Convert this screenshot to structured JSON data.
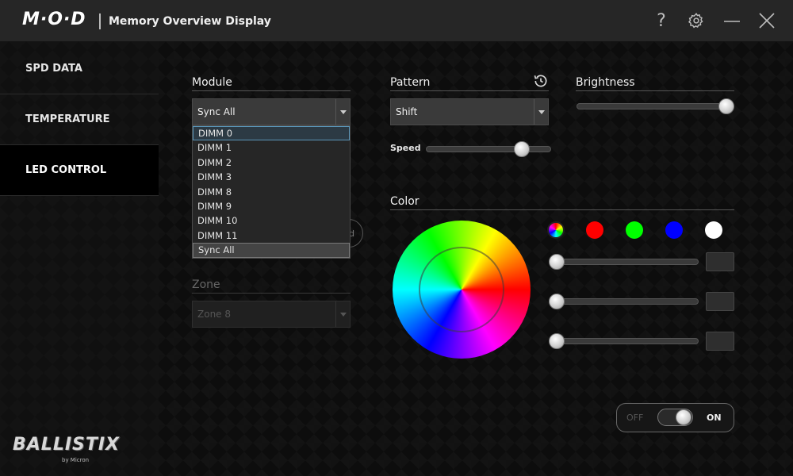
{
  "titlebar": {
    "logo": "M·O·D",
    "title": "Memory Overview Display",
    "help_glyph": "?",
    "icons": [
      "help-icon",
      "gear-icon",
      "minimize-icon",
      "close-icon"
    ]
  },
  "sidebar": {
    "items": [
      {
        "label": "SPD DATA",
        "active": false
      },
      {
        "label": "TEMPERATURE",
        "active": false
      },
      {
        "label": "LED CONTROL",
        "active": true
      }
    ],
    "brand": "BALLISTIX",
    "brand_sub": "by Micron"
  },
  "module": {
    "label": "Module",
    "selected": "Sync All",
    "options": [
      "DIMM 0",
      "DIMM 1",
      "DIMM 2",
      "DIMM 3",
      "DIMM 8",
      "DIMM 9",
      "DIMM 10",
      "DIMM 11",
      "Sync All"
    ],
    "hovered": "DIMM 0"
  },
  "hidden_button_fragment": "d",
  "zone": {
    "label": "Zone",
    "selected": "Zone 8",
    "disabled": true
  },
  "pattern": {
    "label": "Pattern",
    "selected": "Shift",
    "reset_icon": "history-icon"
  },
  "speed": {
    "label": "Speed",
    "value_fraction": 0.8
  },
  "brightness": {
    "label": "Brightness",
    "value_fraction": 1.0
  },
  "color": {
    "label": "Color",
    "swatches": [
      {
        "name": "multicolor",
        "color": "rainbow"
      },
      {
        "name": "red",
        "color": "#ff0000"
      },
      {
        "name": "green",
        "color": "#00ff00"
      },
      {
        "name": "blue",
        "color": "#0000ff"
      },
      {
        "name": "white",
        "color": "#ffffff"
      }
    ],
    "channels": [
      {
        "name": "red",
        "value_fraction": 0.0,
        "box": ""
      },
      {
        "name": "green",
        "value_fraction": 0.0,
        "box": ""
      },
      {
        "name": "blue",
        "value_fraction": 0.0,
        "box": ""
      }
    ]
  },
  "power": {
    "off_label": "OFF",
    "on_label": "ON",
    "state": "on"
  },
  "colors": {
    "titlebar_bg": "#262626",
    "dropdown_hover_border": "#5a95b8"
  }
}
